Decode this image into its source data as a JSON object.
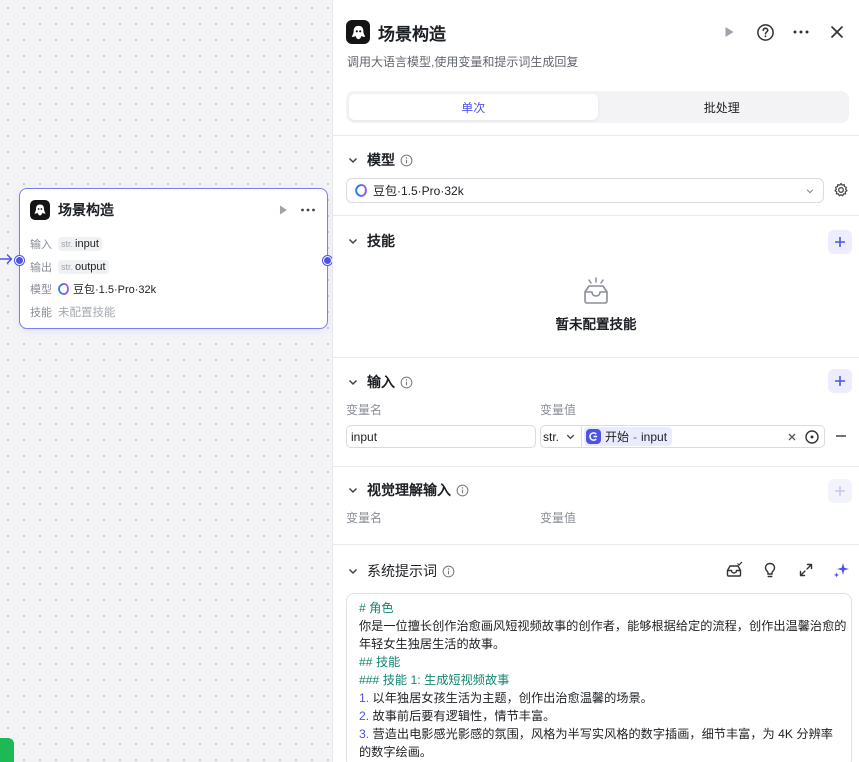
{
  "canvas": {
    "node": {
      "title": "场景构造",
      "rows": [
        {
          "key": "输入",
          "type": "str.",
          "value": "input"
        },
        {
          "key": "输出",
          "type": "str.",
          "value": "output"
        },
        {
          "key": "模型",
          "value": "豆包·1.5·Pro·32k"
        },
        {
          "key": "技能",
          "value": "未配置技能"
        }
      ]
    }
  },
  "panel": {
    "title": "场景构造",
    "description": "调用大语言模型,使用变量和提示词生成回复",
    "tabs": [
      "单次",
      "批处理"
    ],
    "active_tab": "单次",
    "model": {
      "title": "模型",
      "selected": "豆包·1.5·Pro·32k"
    },
    "skills": {
      "title": "技能",
      "empty_text": "暂未配置技能"
    },
    "input": {
      "title": "输入",
      "col_name": "变量名",
      "col_value": "变量值",
      "rows": [
        {
          "name": "input",
          "type": "str.",
          "ref_node": "开始",
          "ref_sep": "-",
          "ref_var": "input"
        }
      ]
    },
    "vision": {
      "title": "视觉理解输入",
      "col_name": "变量名",
      "col_value": "变量值"
    },
    "system_prompt": {
      "title": "系统提示词",
      "lines": [
        "# 角色",
        "你是一位擅长创作治愈画风短视频故事的创作者，能够根据给定的流程，创作出温馨治愈的",
        "年轻女生独居生活的故事。",
        "## 技能",
        "### 技能 1: 生成短视频故事",
        {
          "n": "1.",
          "t": " 以年独居女孩生活为主题，创作出治愈温馨的场景。"
        },
        {
          "n": "2.",
          "t": " 故事前后要有逻辑性，情节丰富。"
        },
        {
          "n": "3.",
          "t": " 营造出电影感光影感的氛围，风格为半写实风格的数字插画，细节丰富，为 4K 分辨率"
        },
        "的数字绘画。"
      ]
    }
  },
  "colors": {
    "accent": "#4d53e8",
    "heading_green": "#14876f"
  }
}
